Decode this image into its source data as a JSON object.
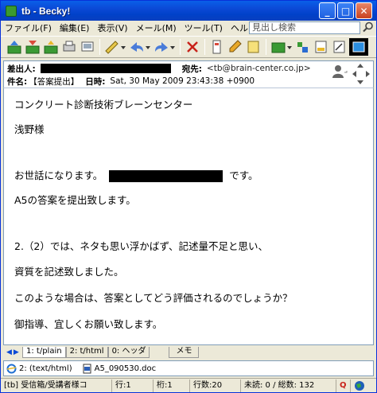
{
  "window": {
    "title": "tb - Becky!"
  },
  "menu": {
    "items": [
      "ファイル(F)",
      "編集(E)",
      "表示(V)",
      "メール(M)",
      "ツール(T)",
      "ヘルプ(H)"
    ],
    "search_placeholder": "見出し検索"
  },
  "header": {
    "from_label": "差出人:",
    "to_label": "宛先:",
    "to_value": "<tb@brain-center.co.jp>",
    "subject_label": "件名:",
    "subject_value": "【答案提出】",
    "date_label": "日時:",
    "date_value": "Sat, 30 May 2009 23:43:38 +0900"
  },
  "body": {
    "lines": [
      "コンクリート診断技術ブレーンセンター",
      "浅野様",
      "お世話になります。",
      "です。",
      "A5の答案を提出致します。",
      "2.（2）では、ネタも思い浮かばず、記述量不足と思い、",
      "資質を記述致しました。",
      "このような場合は、答案としてどう評価されるのでしょうか？",
      "御指導、宜しくお願い致します。"
    ]
  },
  "tabs": {
    "items": [
      "1: t/plain",
      "2: t/html",
      "0: ヘッダ"
    ],
    "memo": "メモ"
  },
  "attachments": {
    "items": [
      "2: (text/html)",
      "A5_090530.doc"
    ]
  },
  "status": {
    "folder": "[tb] 受信箱/受講者様コ",
    "line": "行:1",
    "column": "桁:1",
    "lines": "行数:20",
    "unread": "未読: 0 / 総数: 132",
    "mode": "Q"
  },
  "colors": {
    "titlebar": "#0b49d6",
    "chrome": "#ece9d8",
    "border": "#7f9db9"
  }
}
